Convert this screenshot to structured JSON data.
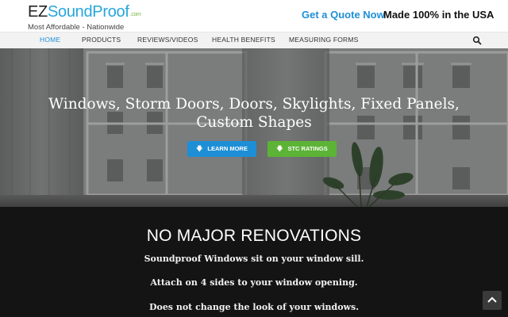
{
  "header": {
    "logo_ez": "EZ",
    "logo_soundproof": "SoundProof",
    "logo_com": ".com",
    "logo_tagline": "Most Affordable - Nationwide",
    "quote_link": "Get a Quote Now",
    "made_usa": "Made 100% in the USA"
  },
  "nav": {
    "items": [
      "HOME",
      "PRODUCTS",
      "REVIEWS/VIDEOS",
      "HEALTH BENEFITS",
      "MEASURING FORMS"
    ],
    "active": "HOME",
    "search_icon": "search-icon"
  },
  "hero": {
    "title_line1": "Windows, Storm Doors, Doors, Skylights, Fixed Panels,",
    "title_line2": "Custom Shapes",
    "btn_learn": "LEARN MORE",
    "btn_stc": "STC RATINGS"
  },
  "section": {
    "title": "NO MAJOR RENOVATIONS",
    "lines": [
      "Soundproof Windows sit on your window sill.",
      "Attach on 4 sides to your window opening.",
      "Does not change the look of your windows."
    ]
  },
  "colors": {
    "accent_blue": "#1e8fd6",
    "accent_green": "#5cb336",
    "dark_bg": "#141414"
  },
  "icons": {
    "back_to_top": "chevron-up-icon",
    "button_arrow": "arrow-down-icon"
  }
}
